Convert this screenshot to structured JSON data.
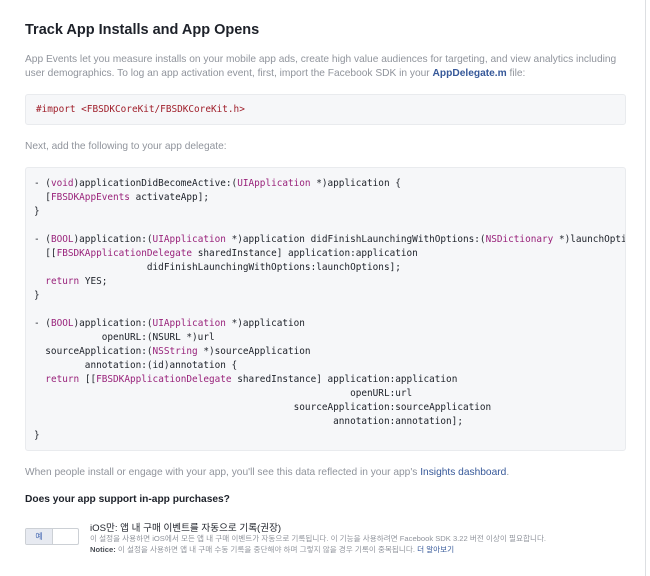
{
  "page": {
    "title": "Track App Installs and App Opens",
    "intro_text": "App Events let you measure installs on your mobile app ads, create high value audiences for targeting, and view analytics including user demographics. To log an app activation event, first, import the Facebook SDK in your ",
    "intro_link": "AppDelegate.m",
    "intro_suffix": " file:",
    "import_prefix": "#import ",
    "import_path": "<FBSDKCoreKit/FBSDKCoreKit.h>",
    "next_text": "Next, add the following to your app delegate:",
    "insights_text": "When people install or engage with your app, you'll see this data reflected in your app's ",
    "insights_link": "Insights dashboard",
    "insights_suffix": ".",
    "question": "Does your app support in-app purchases?"
  },
  "code": {
    "l1a": "- (",
    "l1b": "void",
    "l1c": ")applicationDidBecomeActive:(",
    "l1d": "UIApplication",
    "l1e": " *)application {",
    "l2a": "  [",
    "l2b": "FBSDKAppEvents",
    "l2c": " activateApp];",
    "l3": "}",
    "l5a": "- (",
    "l5b": "BOOL",
    "l5c": ")application:(",
    "l5d": "UIApplication",
    "l5e": " *)application didFinishLaunchingWithOptions:(",
    "l5f": "NSDictionary",
    "l5g": " *)launchOptions {",
    "l6a": "  [[",
    "l6b": "FBSDKApplicationDelegate",
    "l6c": " sharedInstance] application:application",
    "l7": "                    didFinishLaunchingWithOptions:launchOptions];",
    "l8a": "  ",
    "l8b": "return",
    "l8c": " YES;",
    "l9": "}",
    "l11a": "- (",
    "l11b": "BOOL",
    "l11c": ")application:(",
    "l11d": "UIApplication",
    "l11e": " *)application",
    "l12": "            openURL:(NSURL *)url",
    "l13a": "  sourceApplication:(",
    "l13b": "NSString",
    "l13c": " *)sourceApplication",
    "l14": "         annotation:(id)annotation {",
    "l15a": "  ",
    "l15b": "return",
    "l15c": " [[",
    "l15d": "FBSDKApplicationDelegate",
    "l15e": " sharedInstance] application:application",
    "l16": "                                                        openURL:url",
    "l17": "                                              sourceApplication:sourceApplication",
    "l18": "                                                     annotation:annotation];",
    "l19": "}"
  },
  "iap": {
    "toggle_label": "예",
    "title": "iOS만: 앱 내 구매 이벤트를 자동으로 기록(권장)",
    "desc1": "이 설정을 사용하면 iOS에서 모든 앱 내 구매 이벤트가 자동으로 기록됩니다. 이 기능을 사용하려면 Facebook SDK 3.22 버전 이상이 필요합니다.",
    "notice_label": "Notice:",
    "desc2": " 이 설정을 사용하면 앱 내 구매 수동 기록을 중단해야 하며 그렇지 않을 경우 기록이 중복됩니다. ",
    "learn_more": "더 알아보기"
  },
  "colors": {
    "link": "#365899",
    "keyword": "#99237b",
    "preprocessor": "#a0202c",
    "code_bg": "#f6f7f9"
  }
}
